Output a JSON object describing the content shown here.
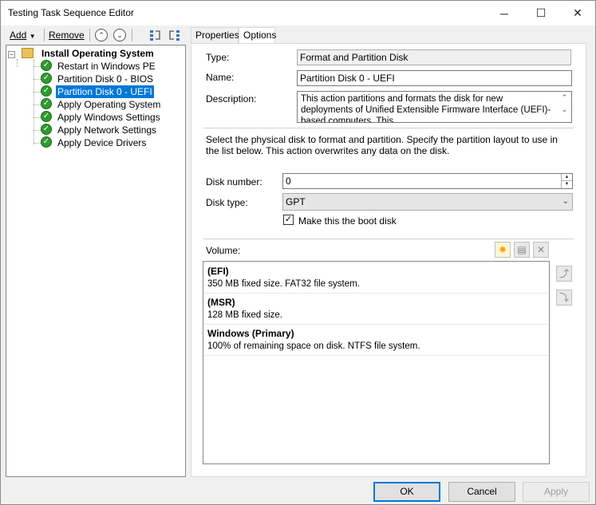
{
  "window": {
    "title": "Testing Task Sequence Editor",
    "minimize": "─",
    "maximize": "☐",
    "close": "✕"
  },
  "toolbar": {
    "add_label": "Add",
    "remove_label": "Remove"
  },
  "tree": {
    "root": "Install Operating System",
    "items": [
      {
        "label": "Restart in Windows PE"
      },
      {
        "label": "Partition Disk 0 - BIOS"
      },
      {
        "label": "Partition Disk 0 - UEFI"
      },
      {
        "label": "Apply Operating System"
      },
      {
        "label": "Apply Windows Settings"
      },
      {
        "label": "Apply Network Settings"
      },
      {
        "label": "Apply Device Drivers"
      }
    ],
    "selected": "Partition Disk 0 - UEFI"
  },
  "tabs": [
    {
      "label": "Properties"
    },
    {
      "label": "Options"
    }
  ],
  "properties": {
    "type_label": "Type:",
    "type_value": "Format and Partition Disk",
    "name_label": "Name:",
    "name_value": "Partition Disk 0 - UEFI",
    "description_label": "Description:",
    "description_value": "This action partitions and formats the disk for new deployments of Unified Extensible Firmware Interface (UEFI)-based computers. This",
    "instructions": "Select the physical disk to format and partition. Specify the partition layout to use in the list below. This action overwrites any data on the disk.",
    "disk_number_label": "Disk number:",
    "disk_number_value": "0",
    "disk_type_label": "Disk type:",
    "disk_type_value": "GPT",
    "boot_disk_label": "Make this the boot disk",
    "boot_disk_checked": true,
    "volume_label": "Volume:"
  },
  "volumes": [
    {
      "name": "(EFI)",
      "desc": "350 MB fixed size. FAT32 file system."
    },
    {
      "name": "(MSR)",
      "desc": "128 MB fixed size."
    },
    {
      "name": "Windows (Primary)",
      "desc": "100% of remaining space on disk. NTFS file system."
    }
  ],
  "buttons": {
    "ok": "OK",
    "cancel": "Cancel",
    "apply": "Apply"
  }
}
